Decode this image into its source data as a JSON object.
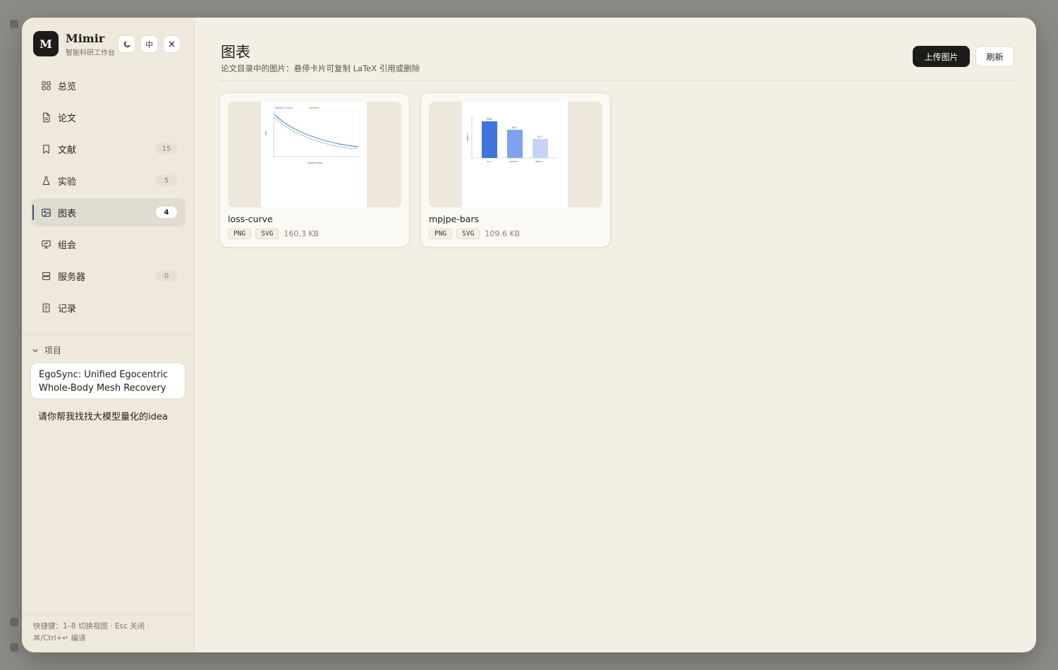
{
  "app": {
    "name": "Mimir",
    "subtitle": "智能科研工作台",
    "logo_letter": "M"
  },
  "top_buttons": {
    "theme_icon": "moon-icon",
    "lang_label": "中",
    "close_icon": "close-icon"
  },
  "nav": [
    {
      "label": "总览",
      "icon": "grid-icon",
      "badge": null
    },
    {
      "label": "论文",
      "icon": "document-icon",
      "badge": null
    },
    {
      "label": "文献",
      "icon": "bookmark-icon",
      "badge": "15"
    },
    {
      "label": "实验",
      "icon": "flask-icon",
      "badge": "5"
    },
    {
      "label": "图表",
      "icon": "image-icon",
      "badge": "4",
      "active": true
    },
    {
      "label": "组会",
      "icon": "presentation-icon",
      "badge": null
    },
    {
      "label": "服务器",
      "icon": "server-icon",
      "badge": "0"
    },
    {
      "label": "记录",
      "icon": "notes-icon",
      "badge": null
    }
  ],
  "projects": {
    "header": "项目",
    "items": [
      {
        "title": "EgoSync: Unified Egocentric Whole-Body Mesh Recovery",
        "selected": true
      },
      {
        "title": "请你帮我找找大模型量化的idea",
        "selected": false
      }
    ]
  },
  "shortcut_hint": "快捷键：1–8 切换视图 · Esc 关闭 · ⌘/Ctrl+↵ 编译",
  "page": {
    "title": "图表",
    "subtitle": "论文目录中的图片：悬停卡片可复制 LaTeX 引用或删除",
    "upload_label": "上传图片",
    "refresh_label": "刷新"
  },
  "figures": [
    {
      "name": "loss-curve",
      "formats": [
        "PNG",
        "SVG"
      ],
      "size": "160.3 KB"
    },
    {
      "name": "mpjpe-bars",
      "formats": [
        "PNG",
        "SVG"
      ],
      "size": "109.6 KB"
    }
  ],
  "colors": {
    "accent_dark": "#1e1c19",
    "active_indicator": "#3c4e74",
    "bar_1": "#3e74e0",
    "bar_2": "#7ea3ee",
    "bar_3": "#c3d4f8",
    "curve_1": "#3a6fd8",
    "curve_2": "#3a9a5a"
  }
}
